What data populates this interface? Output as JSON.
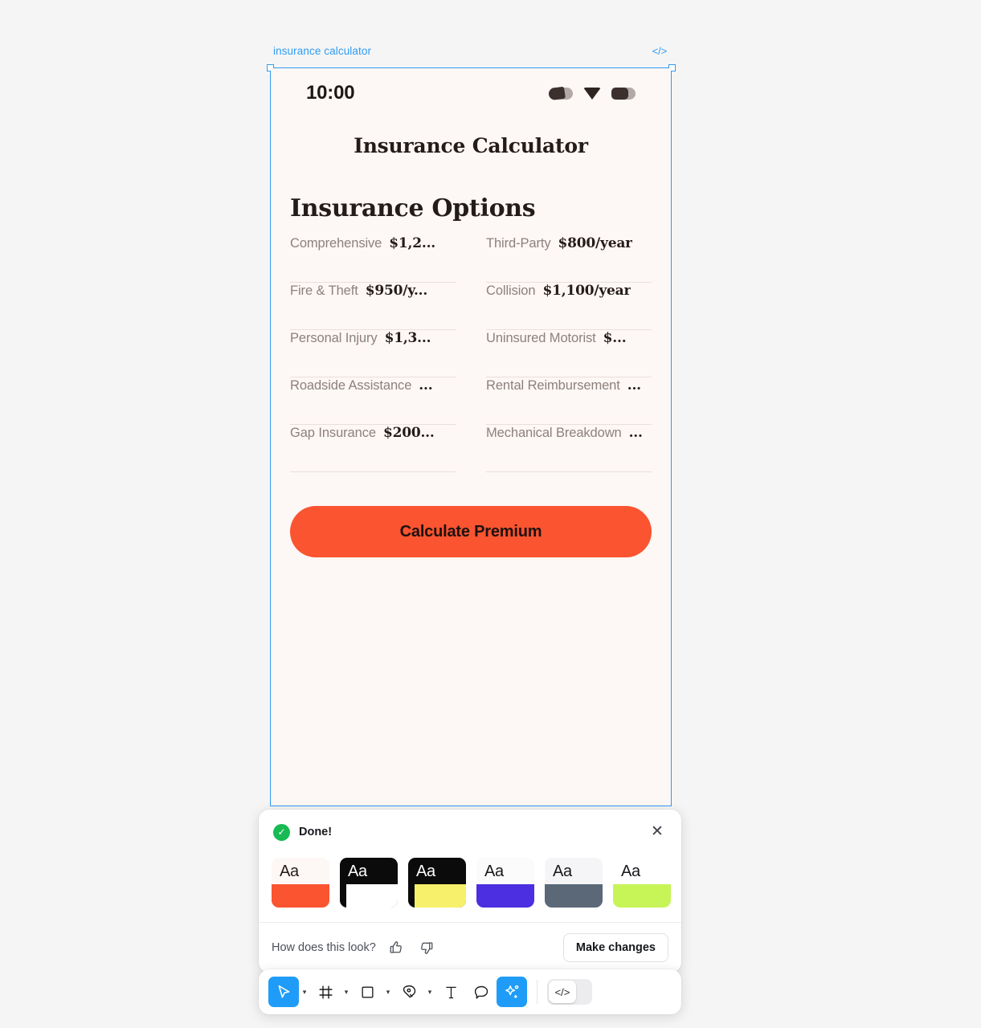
{
  "frame": {
    "label": "insurance calculator",
    "code_icon": "</>",
    "accent": "#2f9cf4"
  },
  "phone": {
    "background": "#fdf7f5",
    "status_bar": {
      "time": "10:00",
      "icons": [
        "signal-icon",
        "wifi-icon",
        "battery-icon"
      ]
    },
    "app_title": "Insurance Calculator",
    "section_title": "Insurance Options",
    "options": [
      {
        "name": "Comprehensive",
        "price": "$1,2..."
      },
      {
        "name": "Third-Party",
        "price": "$800/year"
      },
      {
        "name": "Fire & Theft",
        "price": "$950/y..."
      },
      {
        "name": "Collision",
        "price": "$1,100/year"
      },
      {
        "name": "Personal Injury",
        "price": "$1,3..."
      },
      {
        "name": "Uninsured Motorist",
        "price": "$..."
      },
      {
        "name": "Roadside Assistance",
        "price": "..."
      },
      {
        "name": "Rental Reimbursement",
        "price": "..."
      },
      {
        "name": "Gap Insurance",
        "price": "$200..."
      },
      {
        "name": "Mechanical Breakdown",
        "price": "..."
      }
    ],
    "cta": {
      "label": "Calculate Premium",
      "color": "#fa5430"
    }
  },
  "panel": {
    "status_text": "Done!",
    "check_icon": "✓",
    "close_icon": "✕",
    "swatches": [
      {
        "name": "theme-coral",
        "card_bg": "#fdf7f5",
        "text_color": "#241c19",
        "block": "#fa5430",
        "block_inset": false,
        "sample": "Aa"
      },
      {
        "name": "theme-black-white",
        "card_bg": "#0b0b0b",
        "text_color": "#ffffff",
        "block": "#ffffff",
        "block_inset": true,
        "sample": "Aa"
      },
      {
        "name": "theme-black-yellow",
        "card_bg": "#0b0b0b",
        "text_color": "#ffffff",
        "block": "#f7f06a",
        "block_inset": true,
        "sample": "Aa"
      },
      {
        "name": "theme-violet",
        "card_bg": "#fbfbfb",
        "text_color": "#16181c",
        "block": "#4b2fe0",
        "block_inset": false,
        "sample": "Aa"
      },
      {
        "name": "theme-slate",
        "card_bg": "#f5f5f7",
        "text_color": "#16181c",
        "block": "#5a6878",
        "block_inset": false,
        "sample": "Aa"
      },
      {
        "name": "theme-lime",
        "card_bg": "#ffffff",
        "text_color": "#16181c",
        "block": "#c7f558",
        "block_inset": false,
        "sample": "Aa"
      }
    ],
    "feedback_question": "How does this look?",
    "make_changes_label": "Make changes"
  },
  "toolbar": {
    "tools": [
      {
        "name": "move-tool",
        "active": true,
        "caret": true
      },
      {
        "name": "frame-tool",
        "active": false,
        "caret": true
      },
      {
        "name": "shape-tool",
        "active": false,
        "caret": true
      },
      {
        "name": "pen-tool",
        "active": false,
        "caret": true
      },
      {
        "name": "text-tool",
        "active": false,
        "caret": false
      },
      {
        "name": "comment-tool",
        "active": false,
        "caret": false
      },
      {
        "name": "ai-actions-tool",
        "active": true,
        "caret": false
      }
    ],
    "code_toggle": {
      "name": "code-view-toggle",
      "icon": "</>",
      "on": false
    }
  }
}
